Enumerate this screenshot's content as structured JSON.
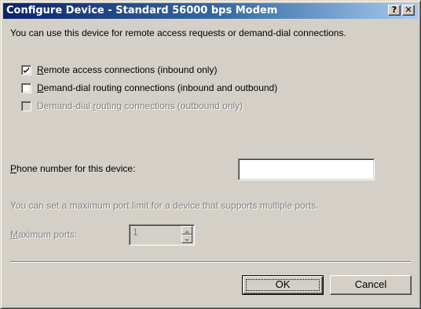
{
  "window": {
    "title": "Configure Device - Standard 56000 bps Modem",
    "help_glyph": "?",
    "close_glyph": "✕"
  },
  "intro_text": "You can use this device for remote access requests or demand-dial connections.",
  "options": [
    {
      "label_key": "R",
      "label_rest": "emote access connections (inbound only)",
      "checked": true,
      "enabled": true
    },
    {
      "label_key": "D",
      "label_rest": "emand-dial routing connections (inbound and outbound)",
      "checked": false,
      "enabled": true
    },
    {
      "label_pre": "Demand-dial ",
      "label_key": "r",
      "label_rest": "outing connections (outbound only)",
      "checked": false,
      "enabled": false
    }
  ],
  "phone": {
    "label_key": "P",
    "label_rest": "hone number for this device:",
    "value": ""
  },
  "port_info_text": "You can set a maximum port limit for a device that supports multiple ports.",
  "max_ports": {
    "label_key": "M",
    "label_rest": "aximum ports:",
    "value": "1"
  },
  "buttons": {
    "ok_label": "OK",
    "cancel_label": "Cancel"
  }
}
